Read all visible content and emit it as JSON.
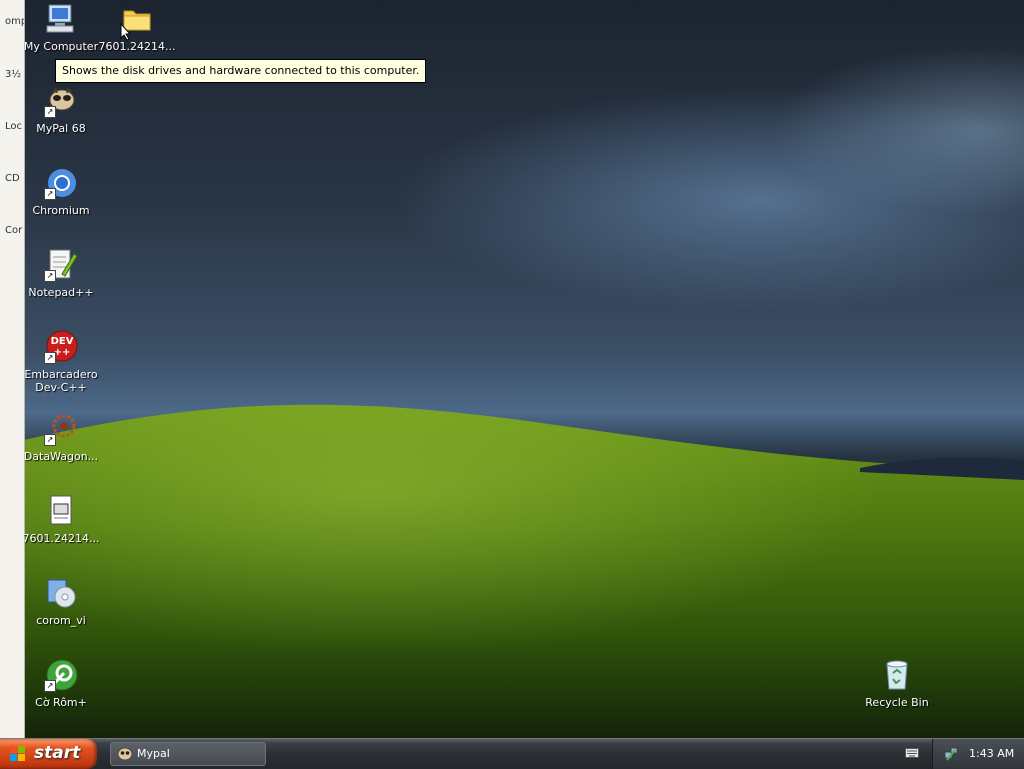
{
  "left_strip": {
    "items": [
      "omp",
      "3½",
      "Loc",
      "CD",
      "Cor"
    ]
  },
  "desktop": {
    "icons": [
      {
        "label": "My Computer",
        "icon": "computer-icon"
      },
      {
        "label": "7601.24214...",
        "icon": "folder-icon"
      },
      {
        "label": "MyPal 68",
        "icon": "mypal-icon"
      },
      {
        "label": "Chromium",
        "icon": "chromium-icon"
      },
      {
        "label": "Notepad++",
        "icon": "notepad-plus-plus-icon"
      },
      {
        "label": "Embarcadero\nDev-C++",
        "label_line1": "Embarcadero",
        "label_line2": "Dev-C++",
        "icon": "devcpp-icon"
      },
      {
        "label": "DataWagon...",
        "icon": "datawagon-icon"
      },
      {
        "label": "7601.24214...",
        "icon": "document-icon"
      },
      {
        "label": "corom_vi",
        "icon": "cd-installer-icon"
      },
      {
        "label": "Cờ Rôm+",
        "icon": "cotrom-icon"
      },
      {
        "label": "Recycle Bin",
        "icon": "recycle-bin-icon"
      }
    ]
  },
  "tooltip": {
    "text": "Shows the disk drives and hardware connected to this computer."
  },
  "taskbar": {
    "start_label": "start",
    "tasks": [
      {
        "label": "Mypal",
        "icon": "mypal-icon"
      }
    ],
    "clock": "1:43 AM"
  },
  "colors": {
    "start_button": "#c63b12",
    "taskbar": "#2c2f34",
    "tooltip_bg": "#ffffe1"
  }
}
